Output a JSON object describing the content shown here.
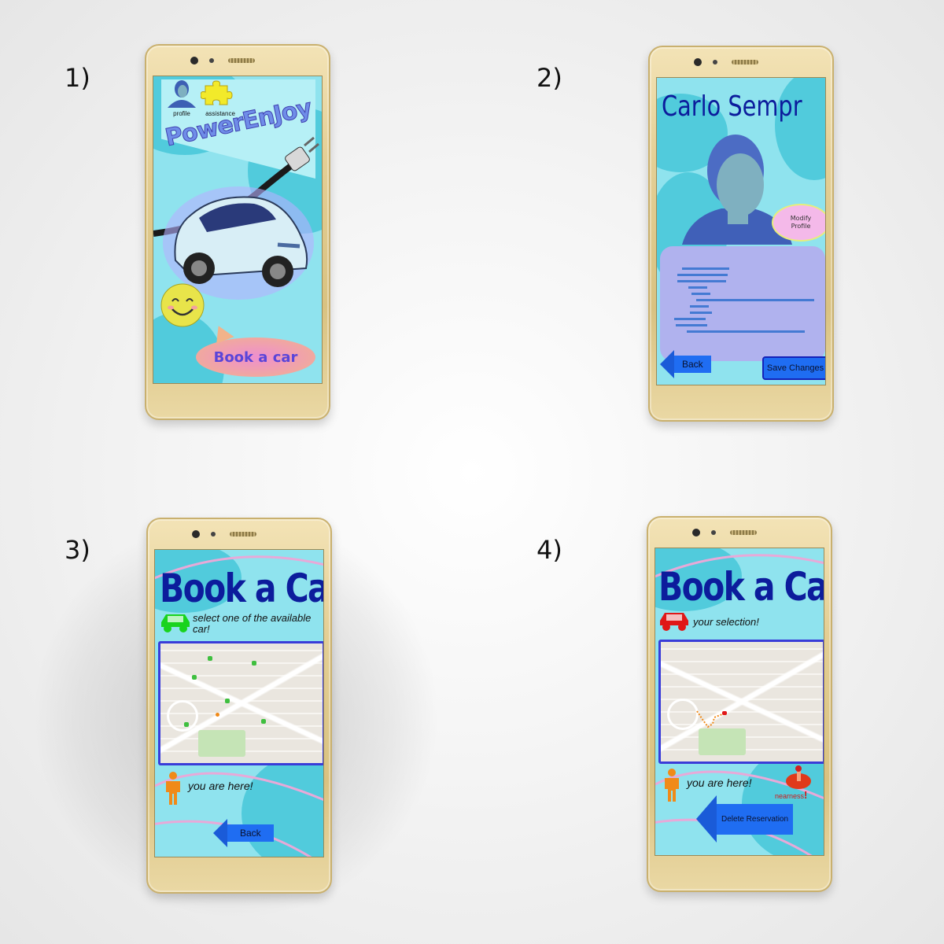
{
  "panels": [
    {
      "number": "1)",
      "app_title": "PowerEnJoy",
      "profile_label": "profile",
      "assistance_label": "assistance",
      "book_button": "Book a car"
    },
    {
      "number": "2)",
      "user_name": "Carlo Sempr",
      "modify_profile": "Modify Profile",
      "back_button": "Back",
      "save_button": "Save Changes"
    },
    {
      "number": "3)",
      "title": "Book a Car",
      "instruction": "select one of the available car!",
      "you_are_here": "you are here!",
      "back_button": "Back"
    },
    {
      "number": "4)",
      "title": "Book a Car",
      "selection_note": "your selection!",
      "you_are_here": "you are here!",
      "nearness": "nearness",
      "delete_button": "Delete Reservation"
    }
  ],
  "colors": {
    "screen_bg": "#8fe3ee",
    "title_blue": "#0c1c9c",
    "button_blue": "#1f6df2",
    "car_green": "#19d31e",
    "car_red": "#e01818",
    "person_orange": "#f08a18"
  }
}
